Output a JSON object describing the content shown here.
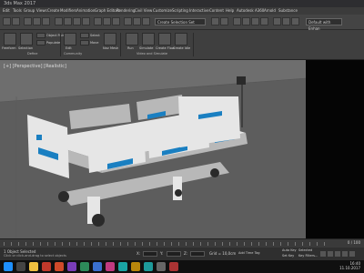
{
  "window": {
    "title": "3ds Max 2017"
  },
  "menu": [
    {
      "label": "Edit"
    },
    {
      "label": "Tools"
    },
    {
      "label": "Group"
    },
    {
      "label": "Views"
    },
    {
      "label": "Create"
    },
    {
      "label": "Modifiers"
    },
    {
      "label": "Animation"
    },
    {
      "label": "Graph Editors"
    },
    {
      "label": "Rendering"
    },
    {
      "label": "Civil View"
    },
    {
      "label": "Customize"
    },
    {
      "label": "Scripting"
    },
    {
      "label": "Interactive"
    },
    {
      "label": "Content"
    },
    {
      "label": "Help"
    },
    {
      "label": "Autodesk A360"
    },
    {
      "label": "Arnold"
    },
    {
      "label": "Substance"
    }
  ],
  "toolbar": {
    "selection_set_value": "Create Selection Set",
    "workspace_value": "Default with Enhan"
  },
  "ribbon": {
    "tools": [
      {
        "label": "Freeform"
      },
      {
        "label": "Selection"
      },
      {
        "label": "Object Paint"
      },
      {
        "label": "Populate"
      },
      {
        "label": "Edit"
      },
      {
        "label": "Select"
      },
      {
        "label": "Move"
      },
      {
        "label": "Nav Mesh"
      },
      {
        "label": "Run"
      },
      {
        "label": "Simulate"
      },
      {
        "label": "Create Flow"
      },
      {
        "label": "Create Idle"
      }
    ],
    "groups": [
      "Define",
      "Community",
      "Video and Simulate"
    ]
  },
  "viewport": {
    "label": "[+] [Perspective] [Realistic]",
    "colors": {
      "viewport_bg": "#6e6e6e",
      "floor": "#5d5d5d",
      "bed_frame": "#e6e6e6",
      "bed_shadow": "#b8b8b8",
      "accent_blue": "#1a7fc1",
      "wheel": "#2a2a2a"
    }
  },
  "timeline": {
    "range": "0 / 100"
  },
  "status": {
    "selected": "1 Object Selected",
    "prompt": "Click or click-and-drag to select objects",
    "x_label": "X:",
    "y_label": "Y:",
    "z_label": "Z:",
    "grid": "Grid = 10,0cm",
    "addtime": "Add Time Tag",
    "autokey": "Auto Key",
    "setkey": "Set Key",
    "selected_dropdown": "Selected",
    "keyfilters": "Key Filters..."
  },
  "taskbar": {
    "icons": [
      {
        "name": "start",
        "color": "#1e90ff"
      },
      {
        "name": "search",
        "color": "#444"
      },
      {
        "name": "explorer",
        "color": "#f0c040"
      },
      {
        "name": "record",
        "color": "#c0392b"
      },
      {
        "name": "app-a",
        "color": "#d04a2a"
      },
      {
        "name": "app-b",
        "color": "#7a3db8"
      },
      {
        "name": "app-c",
        "color": "#2d8a5a"
      },
      {
        "name": "app-d",
        "color": "#3a6fcf"
      },
      {
        "name": "app-e",
        "color": "#c03a80"
      },
      {
        "name": "app-f",
        "color": "#1aa3a3"
      },
      {
        "name": "app-g",
        "color": "#b8860b"
      },
      {
        "name": "3dsmax",
        "color": "#1d9a9a"
      },
      {
        "name": "app-h",
        "color": "#666"
      },
      {
        "name": "app-i",
        "color": "#a33"
      }
    ],
    "clock_time": "16:40",
    "clock_date": "11.10.2017"
  }
}
